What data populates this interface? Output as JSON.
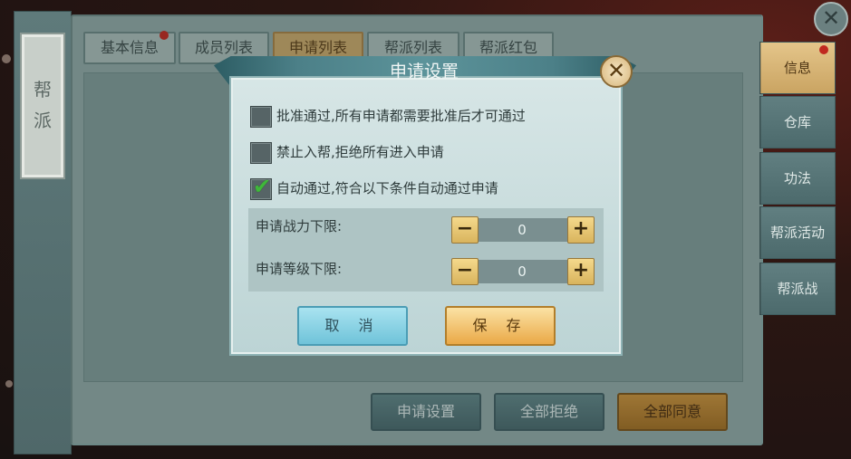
{
  "side_banner": {
    "char1": "帮",
    "char2": "派"
  },
  "tabs": [
    {
      "label": "基本信息",
      "badge": true
    },
    {
      "label": "成员列表",
      "badge": false
    },
    {
      "label": "申请列表",
      "badge": false,
      "active": true
    },
    {
      "label": "帮派列表",
      "badge": false
    },
    {
      "label": "帮派红包",
      "badge": false
    }
  ],
  "right_menu": [
    {
      "label": "信息",
      "active": true,
      "badge": true
    },
    {
      "label": "仓库"
    },
    {
      "label": "功法"
    },
    {
      "label": "帮派活动"
    },
    {
      "label": "帮派战"
    }
  ],
  "bottom_buttons": {
    "apply_settings": "申请设置",
    "reject_all": "全部拒绝",
    "accept_all": "全部同意"
  },
  "dialog": {
    "title": "申请设置",
    "options": [
      {
        "label": "批准通过,所有申请都需要批准后才可通过",
        "checked": false
      },
      {
        "label": "禁止入帮,拒绝所有进入申请",
        "checked": false
      },
      {
        "label": "自动通过,符合以下条件自动通过申请",
        "checked": true
      }
    ],
    "conditions": [
      {
        "label": "申请战力下限:",
        "value": "0"
      },
      {
        "label": "申请等级下限:",
        "value": "0"
      }
    ],
    "cancel_label": "取 消",
    "save_label": "保 存"
  },
  "icons": {
    "close": "close-icon",
    "minus": "minus-icon",
    "plus": "plus-icon",
    "check": "checkmark-icon"
  },
  "colors": {
    "accent_gold": "#e6b85c",
    "panel_teal": "#8fa9a6",
    "check_green": "#3fb83a"
  }
}
